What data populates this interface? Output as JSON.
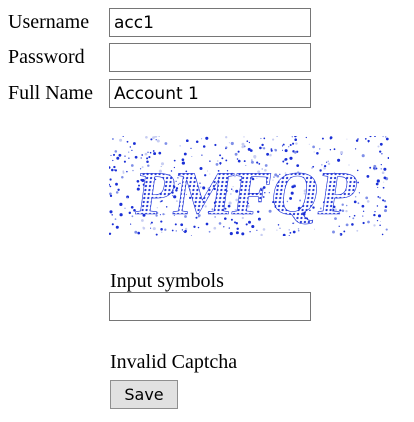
{
  "form": {
    "username": {
      "label": "Username",
      "value": "acc1"
    },
    "password": {
      "label": "Password",
      "value": ""
    },
    "full_name": {
      "label": "Full Name",
      "value": "Account 1"
    }
  },
  "captcha": {
    "image_text": "PMFQP",
    "input_label": "Input symbols",
    "input_value": "",
    "error": "Invalid Captcha",
    "text_color": "#1a2fd6"
  },
  "actions": {
    "save_label": "Save"
  }
}
